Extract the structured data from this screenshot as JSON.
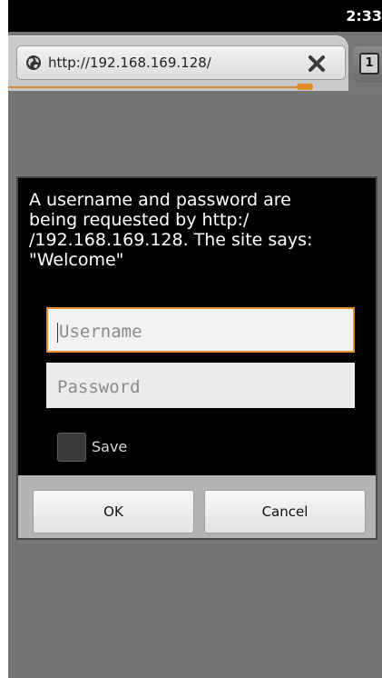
{
  "status_bar": {
    "time": "2:33"
  },
  "browser": {
    "url": "http://192.168.169.128/",
    "tab_count": "1",
    "icons": {
      "site": "globe-icon",
      "stop": "close-icon",
      "tabs": "tabs-icon"
    },
    "accent_color": "#e0902e"
  },
  "dialog": {
    "message": "A username and password are\nbeing requested by http:/\n/192.168.169.128. The site says:\n\"Welcome\"",
    "username": {
      "value": "",
      "placeholder": "Username"
    },
    "password": {
      "value": "",
      "placeholder": "Password"
    },
    "save": {
      "label": "Save",
      "checked": false
    },
    "buttons": {
      "ok": "OK",
      "cancel": "Cancel"
    }
  }
}
